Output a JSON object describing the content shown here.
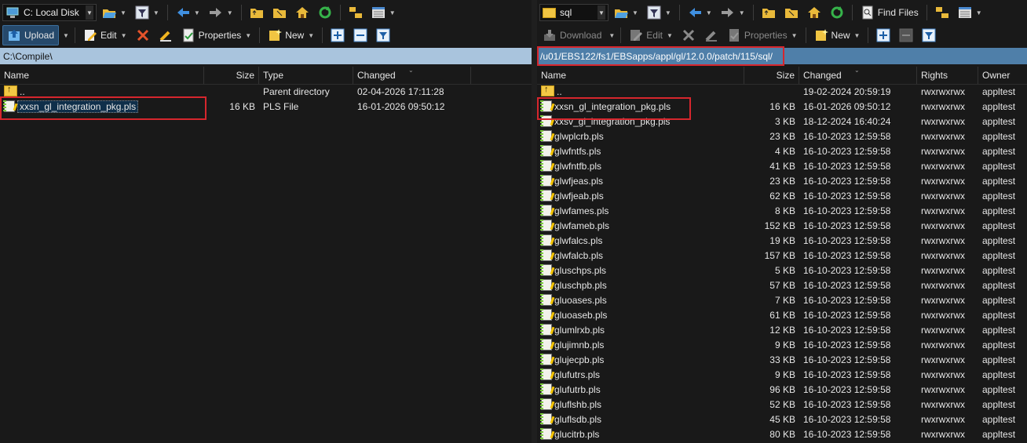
{
  "colors": {
    "accent": "#4f7fa9",
    "path_inactive": "#a9c4dd",
    "highlight_box": "#d6262d",
    "background": "#191919"
  },
  "left": {
    "drive_selector": "C: Local Disk",
    "toolbar": {
      "upload_label": "Upload",
      "edit_label": "Edit",
      "properties_label": "Properties",
      "new_label": "New"
    },
    "path": "C:\\Compile\\",
    "columns": {
      "name": "Name",
      "size": "Size",
      "type": "Type",
      "changed": "Changed"
    },
    "rows": [
      {
        "name": "..",
        "size": "",
        "type": "Parent directory",
        "changed": "02-04-2026 17:11:28",
        "icon": "parent-folder-icon"
      },
      {
        "name": "xxsn_gl_integration_pkg.pls",
        "size": "16 KB",
        "type": "PLS File",
        "changed": "16-01-2026 09:50:12",
        "icon": "file-icon"
      }
    ]
  },
  "right": {
    "folder_selector": "sql",
    "toolbar": {
      "find_files_label": "Find Files",
      "download_label": "Download",
      "edit_label": "Edit",
      "properties_label": "Properties",
      "new_label": "New"
    },
    "path": "/u01/EBS122/fs1/EBSapps/appl/gl/12.0.0/patch/115/sql/",
    "columns": {
      "name": "Name",
      "size": "Size",
      "changed": "Changed",
      "rights": "Rights",
      "owner": "Owner"
    },
    "rows": [
      {
        "name": "..",
        "size": "",
        "changed": "19-02-2024 20:59:19",
        "rights": "rwxrwxrwx",
        "owner": "appltest"
      },
      {
        "name": "xxsn_gl_integration_pkg.pls",
        "size": "16 KB",
        "changed": "16-01-2026 09:50:12",
        "rights": "rwxrwxrwx",
        "owner": "appltest"
      },
      {
        "name": "xxsv_gl_integration_pkg.pls",
        "size": "3 KB",
        "changed": "18-12-2024 16:40:24",
        "rights": "rwxrwxrwx",
        "owner": "appltest"
      },
      {
        "name": "glwplcrb.pls",
        "size": "23 KB",
        "changed": "16-10-2023 12:59:58",
        "rights": "rwxrwxrwx",
        "owner": "appltest"
      },
      {
        "name": "glwfntfs.pls",
        "size": "4 KB",
        "changed": "16-10-2023 12:59:58",
        "rights": "rwxrwxrwx",
        "owner": "appltest"
      },
      {
        "name": "glwfntfb.pls",
        "size": "41 KB",
        "changed": "16-10-2023 12:59:58",
        "rights": "rwxrwxrwx",
        "owner": "appltest"
      },
      {
        "name": "glwfjeas.pls",
        "size": "23 KB",
        "changed": "16-10-2023 12:59:58",
        "rights": "rwxrwxrwx",
        "owner": "appltest"
      },
      {
        "name": "glwfjeab.pls",
        "size": "62 KB",
        "changed": "16-10-2023 12:59:58",
        "rights": "rwxrwxrwx",
        "owner": "appltest"
      },
      {
        "name": "glwfames.pls",
        "size": "8 KB",
        "changed": "16-10-2023 12:59:58",
        "rights": "rwxrwxrwx",
        "owner": "appltest"
      },
      {
        "name": "glwfameb.pls",
        "size": "152 KB",
        "changed": "16-10-2023 12:59:58",
        "rights": "rwxrwxrwx",
        "owner": "appltest"
      },
      {
        "name": "glwfalcs.pls",
        "size": "19 KB",
        "changed": "16-10-2023 12:59:58",
        "rights": "rwxrwxrwx",
        "owner": "appltest"
      },
      {
        "name": "glwfalcb.pls",
        "size": "157 KB",
        "changed": "16-10-2023 12:59:58",
        "rights": "rwxrwxrwx",
        "owner": "appltest"
      },
      {
        "name": "gluschps.pls",
        "size": "5 KB",
        "changed": "16-10-2023 12:59:58",
        "rights": "rwxrwxrwx",
        "owner": "appltest"
      },
      {
        "name": "gluschpb.pls",
        "size": "57 KB",
        "changed": "16-10-2023 12:59:58",
        "rights": "rwxrwxrwx",
        "owner": "appltest"
      },
      {
        "name": "gluoases.pls",
        "size": "7 KB",
        "changed": "16-10-2023 12:59:58",
        "rights": "rwxrwxrwx",
        "owner": "appltest"
      },
      {
        "name": "gluoaseb.pls",
        "size": "61 KB",
        "changed": "16-10-2023 12:59:58",
        "rights": "rwxrwxrwx",
        "owner": "appltest"
      },
      {
        "name": "glumlrxb.pls",
        "size": "12 KB",
        "changed": "16-10-2023 12:59:58",
        "rights": "rwxrwxrwx",
        "owner": "appltest"
      },
      {
        "name": "glujimnb.pls",
        "size": "9 KB",
        "changed": "16-10-2023 12:59:58",
        "rights": "rwxrwxrwx",
        "owner": "appltest"
      },
      {
        "name": "glujecpb.pls",
        "size": "33 KB",
        "changed": "16-10-2023 12:59:58",
        "rights": "rwxrwxrwx",
        "owner": "appltest"
      },
      {
        "name": "glufutrs.pls",
        "size": "9 KB",
        "changed": "16-10-2023 12:59:58",
        "rights": "rwxrwxrwx",
        "owner": "appltest"
      },
      {
        "name": "glufutrb.pls",
        "size": "96 KB",
        "changed": "16-10-2023 12:59:58",
        "rights": "rwxrwxrwx",
        "owner": "appltest"
      },
      {
        "name": "gluflshb.pls",
        "size": "52 KB",
        "changed": "16-10-2023 12:59:58",
        "rights": "rwxrwxrwx",
        "owner": "appltest"
      },
      {
        "name": "gluflsdb.pls",
        "size": "45 KB",
        "changed": "16-10-2023 12:59:58",
        "rights": "rwxrwxrwx",
        "owner": "appltest"
      },
      {
        "name": "glucitrb.pls",
        "size": "80 KB",
        "changed": "16-10-2023 12:59:58",
        "rights": "rwxrwxrwx",
        "owner": "appltest"
      }
    ]
  }
}
